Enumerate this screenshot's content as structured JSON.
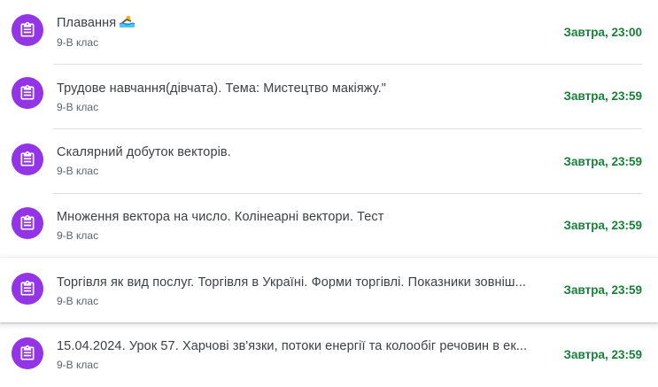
{
  "assignments": [
    {
      "title": "Плавання",
      "emoji": "swimmer-emoji",
      "class": "9-В клас",
      "due": "Завтра, 23:00"
    },
    {
      "title": "Трудове навчання(дівчата). Тема: Мистецтво макіяжу.\"",
      "class": "9-В клас",
      "due": "Завтра, 23:59"
    },
    {
      "title": "Скалярний добуток векторів.",
      "class": "9-В клас",
      "due": "Завтра, 23:59"
    },
    {
      "title": "Множення вектора на число. Колінеарні вектори. Тест",
      "class": "9-В клас",
      "due": "Завтра, 23:59"
    },
    {
      "title": "Торгівля як вид послуг. Торгівля в Україні. Форми торгівлі. Показники зовніш...",
      "class": "9-В клас",
      "due": "Завтра, 23:59"
    },
    {
      "title": "15.04.2024. Урок 57. Харчові зв'язки, потоки енергії та колообіг речовин в ек...",
      "class": "9-В клас",
      "due": "Завтра, 23:59"
    }
  ],
  "colors": {
    "avatar": "#9334e6",
    "due": "#188038",
    "title": "#3c4043",
    "subtitle": "#5f6368"
  },
  "icon": "assignment-icon"
}
